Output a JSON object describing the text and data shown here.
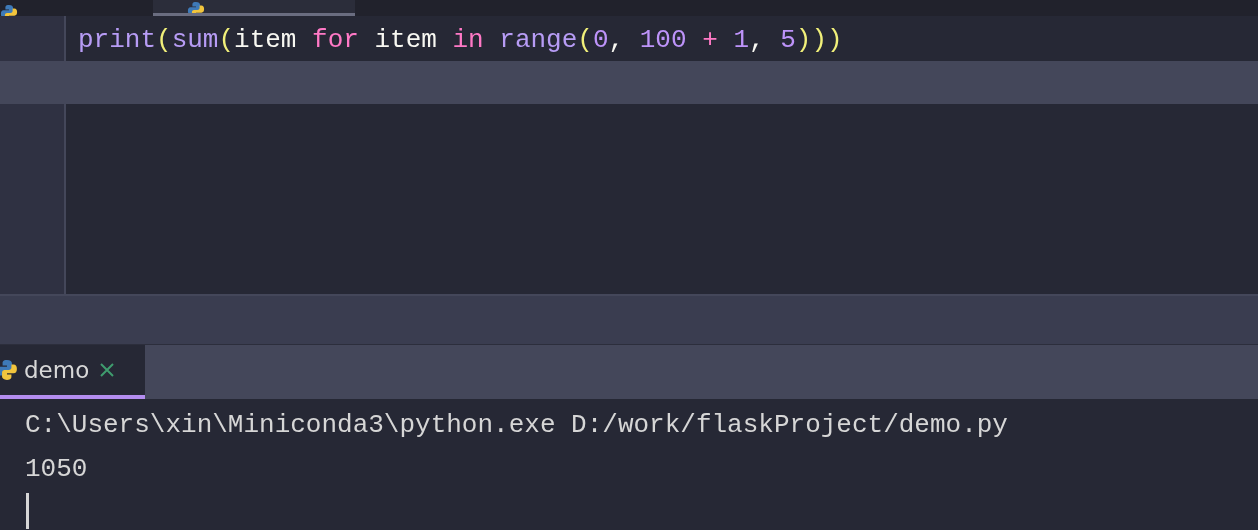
{
  "editor_tabs": [
    {
      "selected": false
    },
    {
      "selected": true
    }
  ],
  "code_lines": [
    {
      "current": false,
      "tokens": [
        {
          "text": "print",
          "kind": "function"
        },
        {
          "text": "(",
          "kind": "paren"
        },
        {
          "text": "sum",
          "kind": "function"
        },
        {
          "text": "(",
          "kind": "paren"
        },
        {
          "text": "item ",
          "kind": "name"
        },
        {
          "text": "for ",
          "kind": "keyword"
        },
        {
          "text": "item ",
          "kind": "name"
        },
        {
          "text": "in ",
          "kind": "keyword"
        },
        {
          "text": "range",
          "kind": "function"
        },
        {
          "text": "(",
          "kind": "paren"
        },
        {
          "text": "0",
          "kind": "number"
        },
        {
          "text": ", ",
          "kind": "name"
        },
        {
          "text": "100 ",
          "kind": "number"
        },
        {
          "text": "+ ",
          "kind": "operator"
        },
        {
          "text": "1",
          "kind": "number"
        },
        {
          "text": ", ",
          "kind": "name"
        },
        {
          "text": "5",
          "kind": "number"
        },
        {
          "text": ")))",
          "kind": "paren"
        }
      ]
    },
    {
      "current": true
    }
  ],
  "run_tabs": [
    {
      "label": "demo",
      "selected": true,
      "closable": true
    }
  ],
  "console": {
    "lines": [
      "C:\\Users\\xin\\Miniconda3\\python.exe D:/work/flaskProject/demo.py",
      "1050"
    ],
    "cursor": true
  }
}
